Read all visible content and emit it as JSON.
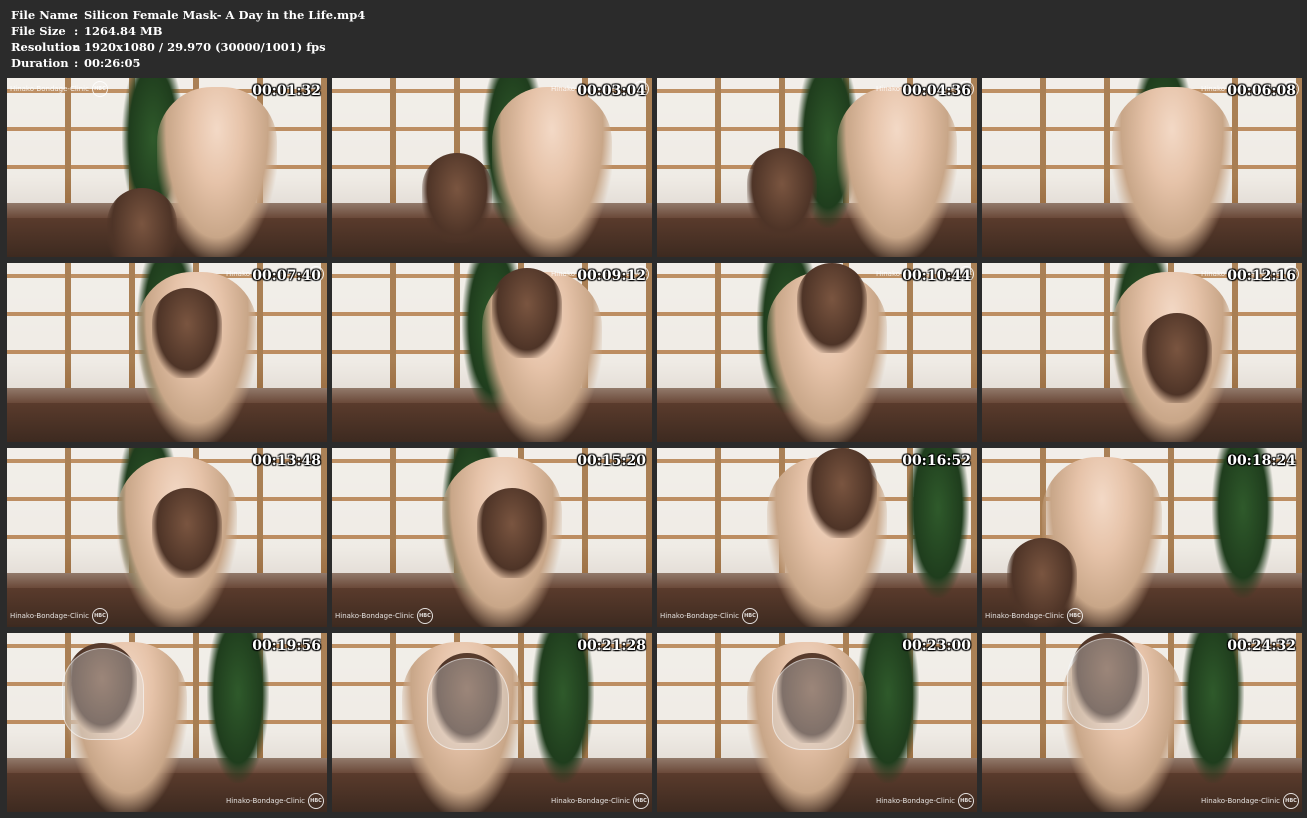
{
  "info": [
    {
      "label": "File Name",
      "sep": ":",
      "value": "Silicon Female Mask- A Day in the Life.mp4"
    },
    {
      "label": "File Size",
      "sep": ":",
      "value": "1264.84 MB"
    },
    {
      "label": "Resolution",
      "sep": ":",
      "value": "1920x1080 / 29.970 (30000/1001) fps"
    },
    {
      "label": "Duration",
      "sep": ":",
      "value": "00:26:05"
    }
  ],
  "watermark": {
    "text": "Hinako-Bondage-Clinic",
    "logo": "HBC"
  },
  "thumbnails": [
    {
      "time": "00:01:32",
      "wm": "top-left"
    },
    {
      "time": "00:03:04",
      "wm": "top-right"
    },
    {
      "time": "00:04:36",
      "wm": "top-right"
    },
    {
      "time": "00:06:08",
      "wm": "top-right"
    },
    {
      "time": "00:07:40",
      "wm": "top-right"
    },
    {
      "time": "00:09:12",
      "wm": "top-right"
    },
    {
      "time": "00:10:44",
      "wm": "top-right"
    },
    {
      "time": "00:12:16",
      "wm": "top-right"
    },
    {
      "time": "00:13:48",
      "wm": "bottom-left"
    },
    {
      "time": "00:15:20",
      "wm": "bottom-left"
    },
    {
      "time": "00:16:52",
      "wm": "bottom-left"
    },
    {
      "time": "00:18:24",
      "wm": "bottom-left"
    },
    {
      "time": "00:19:56",
      "wm": "bottom-right"
    },
    {
      "time": "00:21:28",
      "wm": "bottom-right"
    },
    {
      "time": "00:23:00",
      "wm": "bottom-right"
    },
    {
      "time": "00:24:32",
      "wm": "bottom-right"
    }
  ]
}
